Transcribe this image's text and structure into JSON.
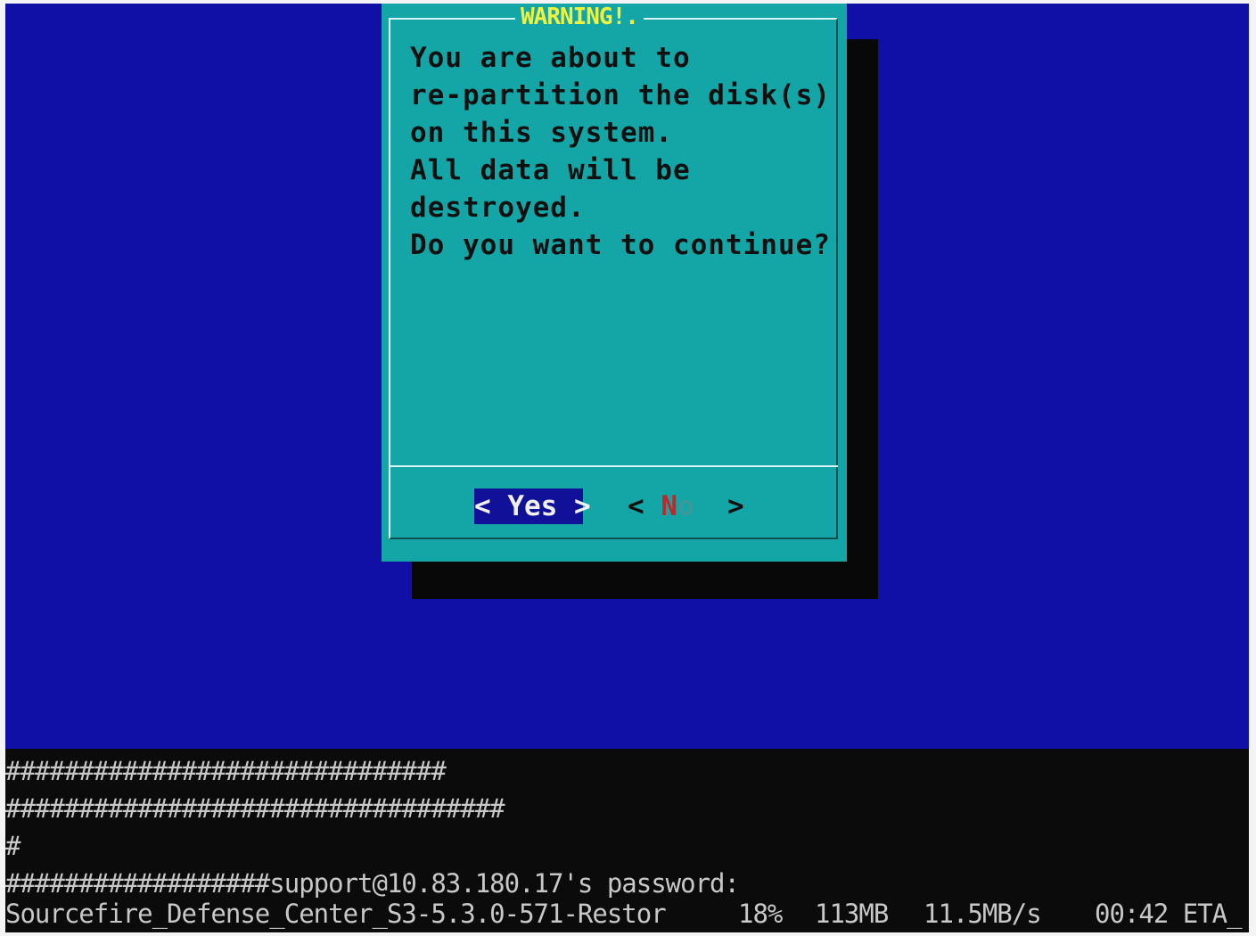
{
  "dialog": {
    "title": "WARNING!.",
    "message_lines": [
      "You are about to",
      "re-partition the disk(s)",
      "on this system.",
      "All data will be",
      "destroyed.",
      "Do you want to continue?"
    ],
    "yes_button": "< Yes >",
    "no_button": {
      "open": "< ",
      "hotkey": "N",
      "rest": "o",
      "close": "  >"
    }
  },
  "terminal": {
    "lines": [
      "##############################",
      "##################################",
      "#",
      "##################support@10.83.180.17's password:"
    ],
    "progress": {
      "file": "Sourcefire_Defense_Center_S3-5.3.0-571-Restor",
      "percent": "18%",
      "size": "113MB",
      "rate": "11.5MB/s",
      "eta": "00:42 ETA_"
    }
  },
  "colors": {
    "background": "#1010a6",
    "dialog": "#14a6a6",
    "title": "#f2f23c",
    "selected_button": "#101098",
    "hotkey": "#c0282a",
    "terminal_bg": "#0b0b0b",
    "terminal_text": "#c8c8c8"
  }
}
